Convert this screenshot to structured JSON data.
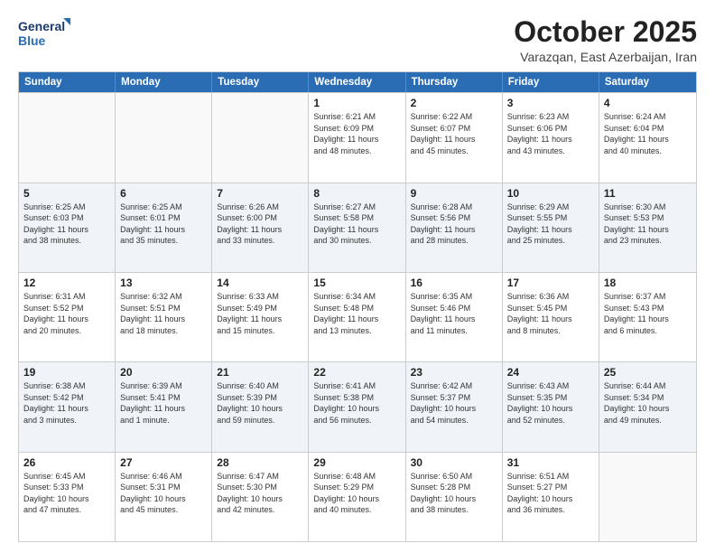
{
  "logo": {
    "line1": "General",
    "line2": "Blue"
  },
  "header": {
    "title": "October 2025",
    "subtitle": "Varazqan, East Azerbaijan, Iran"
  },
  "days": [
    "Sunday",
    "Monday",
    "Tuesday",
    "Wednesday",
    "Thursday",
    "Friday",
    "Saturday"
  ],
  "rows": [
    [
      {
        "day": "",
        "empty": true
      },
      {
        "day": "",
        "empty": true
      },
      {
        "day": "",
        "empty": true
      },
      {
        "day": "1",
        "line1": "Sunrise: 6:21 AM",
        "line2": "Sunset: 6:09 PM",
        "line3": "Daylight: 11 hours",
        "line4": "and 48 minutes."
      },
      {
        "day": "2",
        "line1": "Sunrise: 6:22 AM",
        "line2": "Sunset: 6:07 PM",
        "line3": "Daylight: 11 hours",
        "line4": "and 45 minutes."
      },
      {
        "day": "3",
        "line1": "Sunrise: 6:23 AM",
        "line2": "Sunset: 6:06 PM",
        "line3": "Daylight: 11 hours",
        "line4": "and 43 minutes."
      },
      {
        "day": "4",
        "line1": "Sunrise: 6:24 AM",
        "line2": "Sunset: 6:04 PM",
        "line3": "Daylight: 11 hours",
        "line4": "and 40 minutes."
      }
    ],
    [
      {
        "day": "5",
        "line1": "Sunrise: 6:25 AM",
        "line2": "Sunset: 6:03 PM",
        "line3": "Daylight: 11 hours",
        "line4": "and 38 minutes."
      },
      {
        "day": "6",
        "line1": "Sunrise: 6:25 AM",
        "line2": "Sunset: 6:01 PM",
        "line3": "Daylight: 11 hours",
        "line4": "and 35 minutes."
      },
      {
        "day": "7",
        "line1": "Sunrise: 6:26 AM",
        "line2": "Sunset: 6:00 PM",
        "line3": "Daylight: 11 hours",
        "line4": "and 33 minutes."
      },
      {
        "day": "8",
        "line1": "Sunrise: 6:27 AM",
        "line2": "Sunset: 5:58 PM",
        "line3": "Daylight: 11 hours",
        "line4": "and 30 minutes."
      },
      {
        "day": "9",
        "line1": "Sunrise: 6:28 AM",
        "line2": "Sunset: 5:56 PM",
        "line3": "Daylight: 11 hours",
        "line4": "and 28 minutes."
      },
      {
        "day": "10",
        "line1": "Sunrise: 6:29 AM",
        "line2": "Sunset: 5:55 PM",
        "line3": "Daylight: 11 hours",
        "line4": "and 25 minutes."
      },
      {
        "day": "11",
        "line1": "Sunrise: 6:30 AM",
        "line2": "Sunset: 5:53 PM",
        "line3": "Daylight: 11 hours",
        "line4": "and 23 minutes."
      }
    ],
    [
      {
        "day": "12",
        "line1": "Sunrise: 6:31 AM",
        "line2": "Sunset: 5:52 PM",
        "line3": "Daylight: 11 hours",
        "line4": "and 20 minutes."
      },
      {
        "day": "13",
        "line1": "Sunrise: 6:32 AM",
        "line2": "Sunset: 5:51 PM",
        "line3": "Daylight: 11 hours",
        "line4": "and 18 minutes."
      },
      {
        "day": "14",
        "line1": "Sunrise: 6:33 AM",
        "line2": "Sunset: 5:49 PM",
        "line3": "Daylight: 11 hours",
        "line4": "and 15 minutes."
      },
      {
        "day": "15",
        "line1": "Sunrise: 6:34 AM",
        "line2": "Sunset: 5:48 PM",
        "line3": "Daylight: 11 hours",
        "line4": "and 13 minutes."
      },
      {
        "day": "16",
        "line1": "Sunrise: 6:35 AM",
        "line2": "Sunset: 5:46 PM",
        "line3": "Daylight: 11 hours",
        "line4": "and 11 minutes."
      },
      {
        "day": "17",
        "line1": "Sunrise: 6:36 AM",
        "line2": "Sunset: 5:45 PM",
        "line3": "Daylight: 11 hours",
        "line4": "and 8 minutes."
      },
      {
        "day": "18",
        "line1": "Sunrise: 6:37 AM",
        "line2": "Sunset: 5:43 PM",
        "line3": "Daylight: 11 hours",
        "line4": "and 6 minutes."
      }
    ],
    [
      {
        "day": "19",
        "line1": "Sunrise: 6:38 AM",
        "line2": "Sunset: 5:42 PM",
        "line3": "Daylight: 11 hours",
        "line4": "and 3 minutes."
      },
      {
        "day": "20",
        "line1": "Sunrise: 6:39 AM",
        "line2": "Sunset: 5:41 PM",
        "line3": "Daylight: 11 hours",
        "line4": "and 1 minute."
      },
      {
        "day": "21",
        "line1": "Sunrise: 6:40 AM",
        "line2": "Sunset: 5:39 PM",
        "line3": "Daylight: 10 hours",
        "line4": "and 59 minutes."
      },
      {
        "day": "22",
        "line1": "Sunrise: 6:41 AM",
        "line2": "Sunset: 5:38 PM",
        "line3": "Daylight: 10 hours",
        "line4": "and 56 minutes."
      },
      {
        "day": "23",
        "line1": "Sunrise: 6:42 AM",
        "line2": "Sunset: 5:37 PM",
        "line3": "Daylight: 10 hours",
        "line4": "and 54 minutes."
      },
      {
        "day": "24",
        "line1": "Sunrise: 6:43 AM",
        "line2": "Sunset: 5:35 PM",
        "line3": "Daylight: 10 hours",
        "line4": "and 52 minutes."
      },
      {
        "day": "25",
        "line1": "Sunrise: 6:44 AM",
        "line2": "Sunset: 5:34 PM",
        "line3": "Daylight: 10 hours",
        "line4": "and 49 minutes."
      }
    ],
    [
      {
        "day": "26",
        "line1": "Sunrise: 6:45 AM",
        "line2": "Sunset: 5:33 PM",
        "line3": "Daylight: 10 hours",
        "line4": "and 47 minutes."
      },
      {
        "day": "27",
        "line1": "Sunrise: 6:46 AM",
        "line2": "Sunset: 5:31 PM",
        "line3": "Daylight: 10 hours",
        "line4": "and 45 minutes."
      },
      {
        "day": "28",
        "line1": "Sunrise: 6:47 AM",
        "line2": "Sunset: 5:30 PM",
        "line3": "Daylight: 10 hours",
        "line4": "and 42 minutes."
      },
      {
        "day": "29",
        "line1": "Sunrise: 6:48 AM",
        "line2": "Sunset: 5:29 PM",
        "line3": "Daylight: 10 hours",
        "line4": "and 40 minutes."
      },
      {
        "day": "30",
        "line1": "Sunrise: 6:50 AM",
        "line2": "Sunset: 5:28 PM",
        "line3": "Daylight: 10 hours",
        "line4": "and 38 minutes."
      },
      {
        "day": "31",
        "line1": "Sunrise: 6:51 AM",
        "line2": "Sunset: 5:27 PM",
        "line3": "Daylight: 10 hours",
        "line4": "and 36 minutes."
      },
      {
        "day": "",
        "empty": true
      }
    ]
  ]
}
